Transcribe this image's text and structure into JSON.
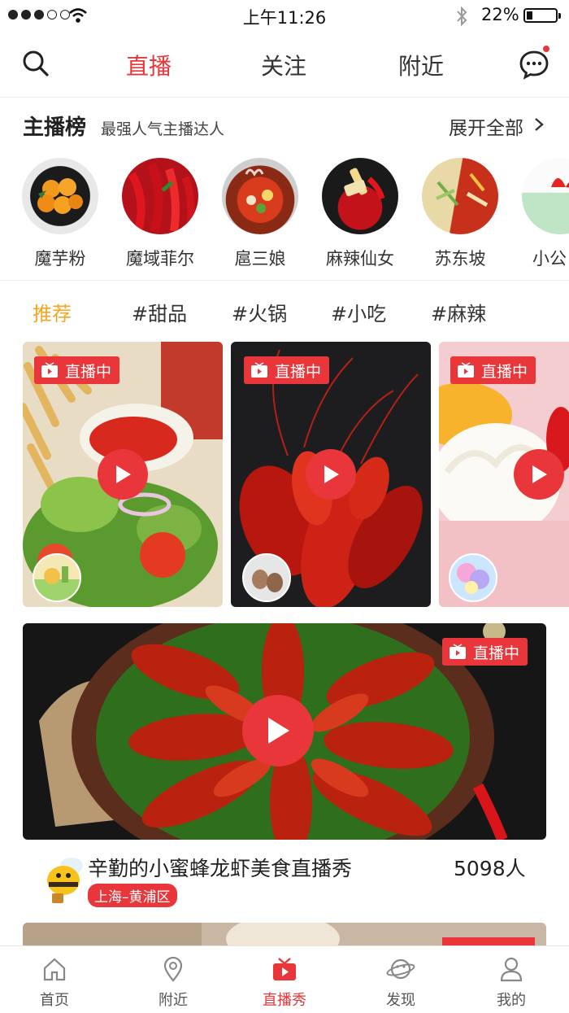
{
  "status_bar": {
    "time": "上午11:26",
    "battery": "22%",
    "battery_level": 0.22
  },
  "header": {
    "tabs": [
      {
        "label": "直播",
        "active": true
      },
      {
        "label": "关注",
        "active": false
      },
      {
        "label": "附近",
        "active": false
      }
    ],
    "icons": [
      "search-icon",
      "chat-icon"
    ]
  },
  "ranking": {
    "title": "主播榜",
    "subtitle": "最强人气主播达人",
    "expand_label": "展开全部",
    "anchors": [
      {
        "name": "魔芋粉"
      },
      {
        "name": "魔域菲尔"
      },
      {
        "name": "扈三娘"
      },
      {
        "name": "麻辣仙女"
      },
      {
        "name": "苏东坡"
      },
      {
        "name": "小公"
      }
    ]
  },
  "categories": [
    {
      "label": "推荐",
      "active": true
    },
    {
      "label": "#甜品",
      "active": false
    },
    {
      "label": "#火锅",
      "active": false
    },
    {
      "label": "#小吃",
      "active": false
    },
    {
      "label": "#麻辣",
      "active": false
    }
  ],
  "live_badge": "直播中",
  "featured": {
    "title": "辛勤的小蜜蜂龙虾美食直播秀",
    "viewers": "5098人",
    "location": "上海–黄浦区"
  },
  "bottom_nav": [
    {
      "label": "首页",
      "icon": "home-icon",
      "active": false
    },
    {
      "label": "附近",
      "icon": "location-pin-icon",
      "active": false
    },
    {
      "label": "直播秀",
      "icon": "tv-icon",
      "active": true
    },
    {
      "label": "发现",
      "icon": "planet-icon",
      "active": false
    },
    {
      "label": "我的",
      "icon": "user-icon",
      "active": false
    }
  ],
  "colors": {
    "accent": "#e9363a",
    "category_active": "#f5a623"
  }
}
